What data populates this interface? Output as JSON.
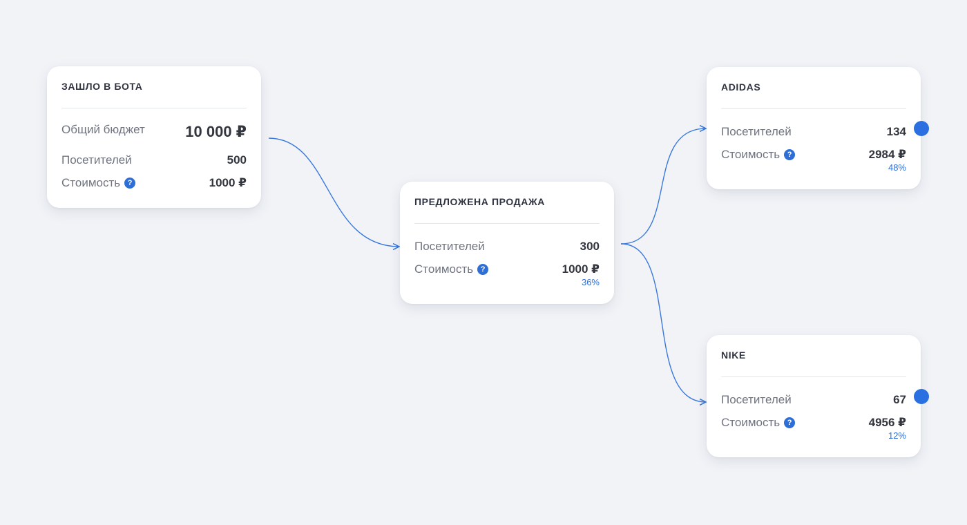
{
  "colors": {
    "background": "#f1f3f7",
    "accent": "#2d6fd6",
    "connector": "#3a78dc",
    "card": "#ffffff"
  },
  "nodes": {
    "entered": {
      "title": "ЗАШЛО В БОТА",
      "budget_label": "Общий бюджет",
      "budget_value": "10 000 ₽",
      "visitors_label": "Посетителей",
      "visitors_value": "500",
      "cost_label": "Стоимость",
      "cost_value": "1000 ₽"
    },
    "offered": {
      "title": "ПРЕДЛОЖЕНА ПРОДАЖА",
      "visitors_label": "Посетителей",
      "visitors_value": "300",
      "cost_label": "Стоимость",
      "cost_value": "1000 ₽",
      "percent": "36%"
    },
    "adidas": {
      "title": "ADIDAS",
      "visitors_label": "Посетителей",
      "visitors_value": "134",
      "cost_label": "Стоимость",
      "cost_value": "2984 ₽",
      "percent": "48%"
    },
    "nike": {
      "title": "NIKE",
      "visitors_label": "Посетителей",
      "visitors_value": "67",
      "cost_label": "Стоимость",
      "cost_value": "4956 ₽",
      "percent": "12%"
    }
  },
  "edges": [
    {
      "from": "entered",
      "to": "offered"
    },
    {
      "from": "offered",
      "to": "adidas"
    },
    {
      "from": "offered",
      "to": "nike"
    }
  ],
  "icons": {
    "help": "?"
  }
}
